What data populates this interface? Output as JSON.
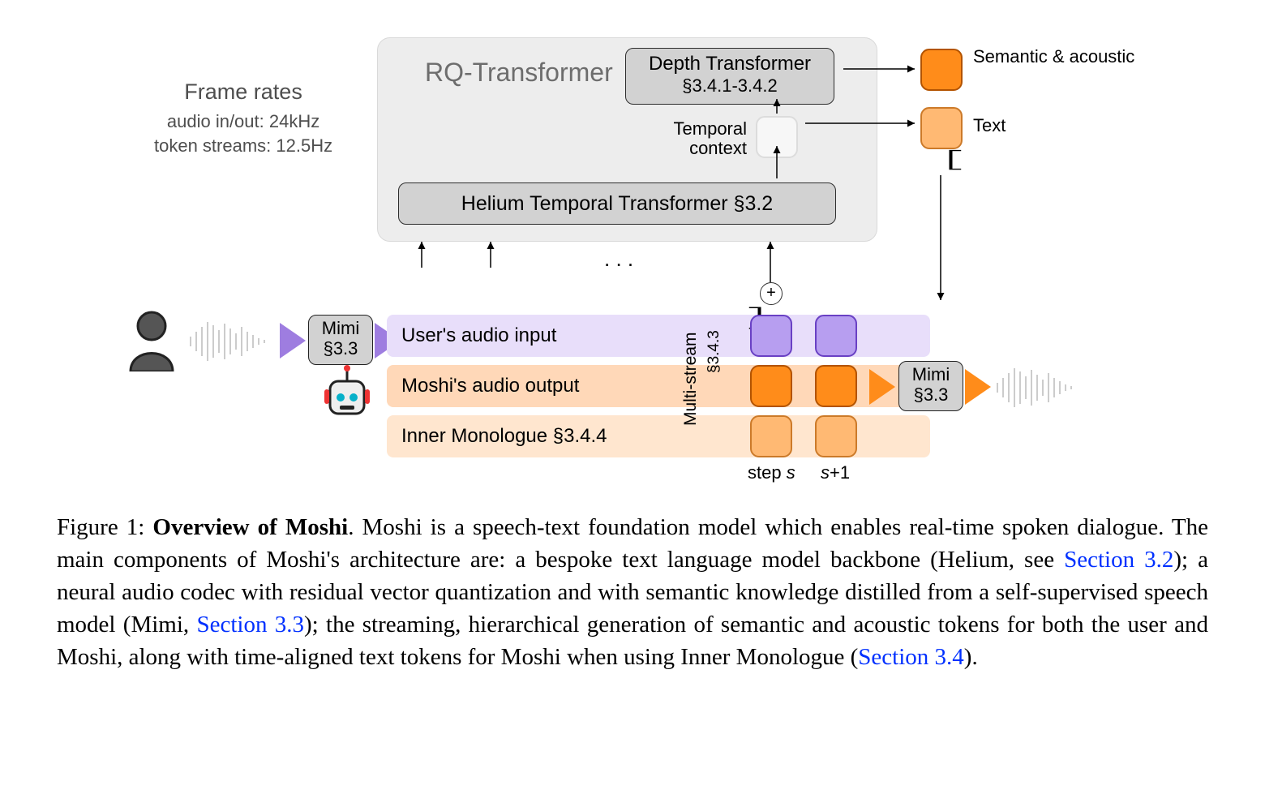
{
  "frame_rates": {
    "title": "Frame rates",
    "audio": "audio in/out: 24kHz",
    "tokens": "token streams: 12.5Hz"
  },
  "rq": {
    "title": "RQ-Transformer"
  },
  "depth": {
    "title": "Depth Transformer",
    "ref": "§3.4.1-3.4.2"
  },
  "temporal_context": "Temporal context",
  "helium": "Helium Temporal Transformer §3.2",
  "outputs": {
    "semantic": "Semantic & acoustic",
    "text": "Text"
  },
  "mimi": {
    "name": "Mimi",
    "ref": "§3.3"
  },
  "streams": {
    "user": "User's audio input",
    "moshi": "Moshi's audio output",
    "inner": "Inner Monologue §3.4.4"
  },
  "multistream": {
    "label": "Multi-stream",
    "ref": "§3.4.3"
  },
  "steps": {
    "s": "step s",
    "s1": "s+1"
  },
  "ellipsis": ". . .",
  "caption": {
    "fig": "Figure 1: ",
    "title": "Overview of Moshi",
    "p1": ".  Moshi is a speech-text foundation model which enables real-time spoken dialogue.  The main components of Moshi's architecture are:  a bespoke text language model backbone (Helium, see ",
    "l1": "Section 3.2",
    "p2": "); a neural audio codec with residual vector quantization and with semantic knowledge distilled from a self-supervised speech model (Mimi, ",
    "l2": "Section 3.3",
    "p3": "); the streaming, hierarchical generation of semantic and acoustic tokens for both the user and Moshi, along with time-aligned text tokens for Moshi when using Inner Monologue (",
    "l3": "Section 3.4",
    "p4": ")."
  }
}
